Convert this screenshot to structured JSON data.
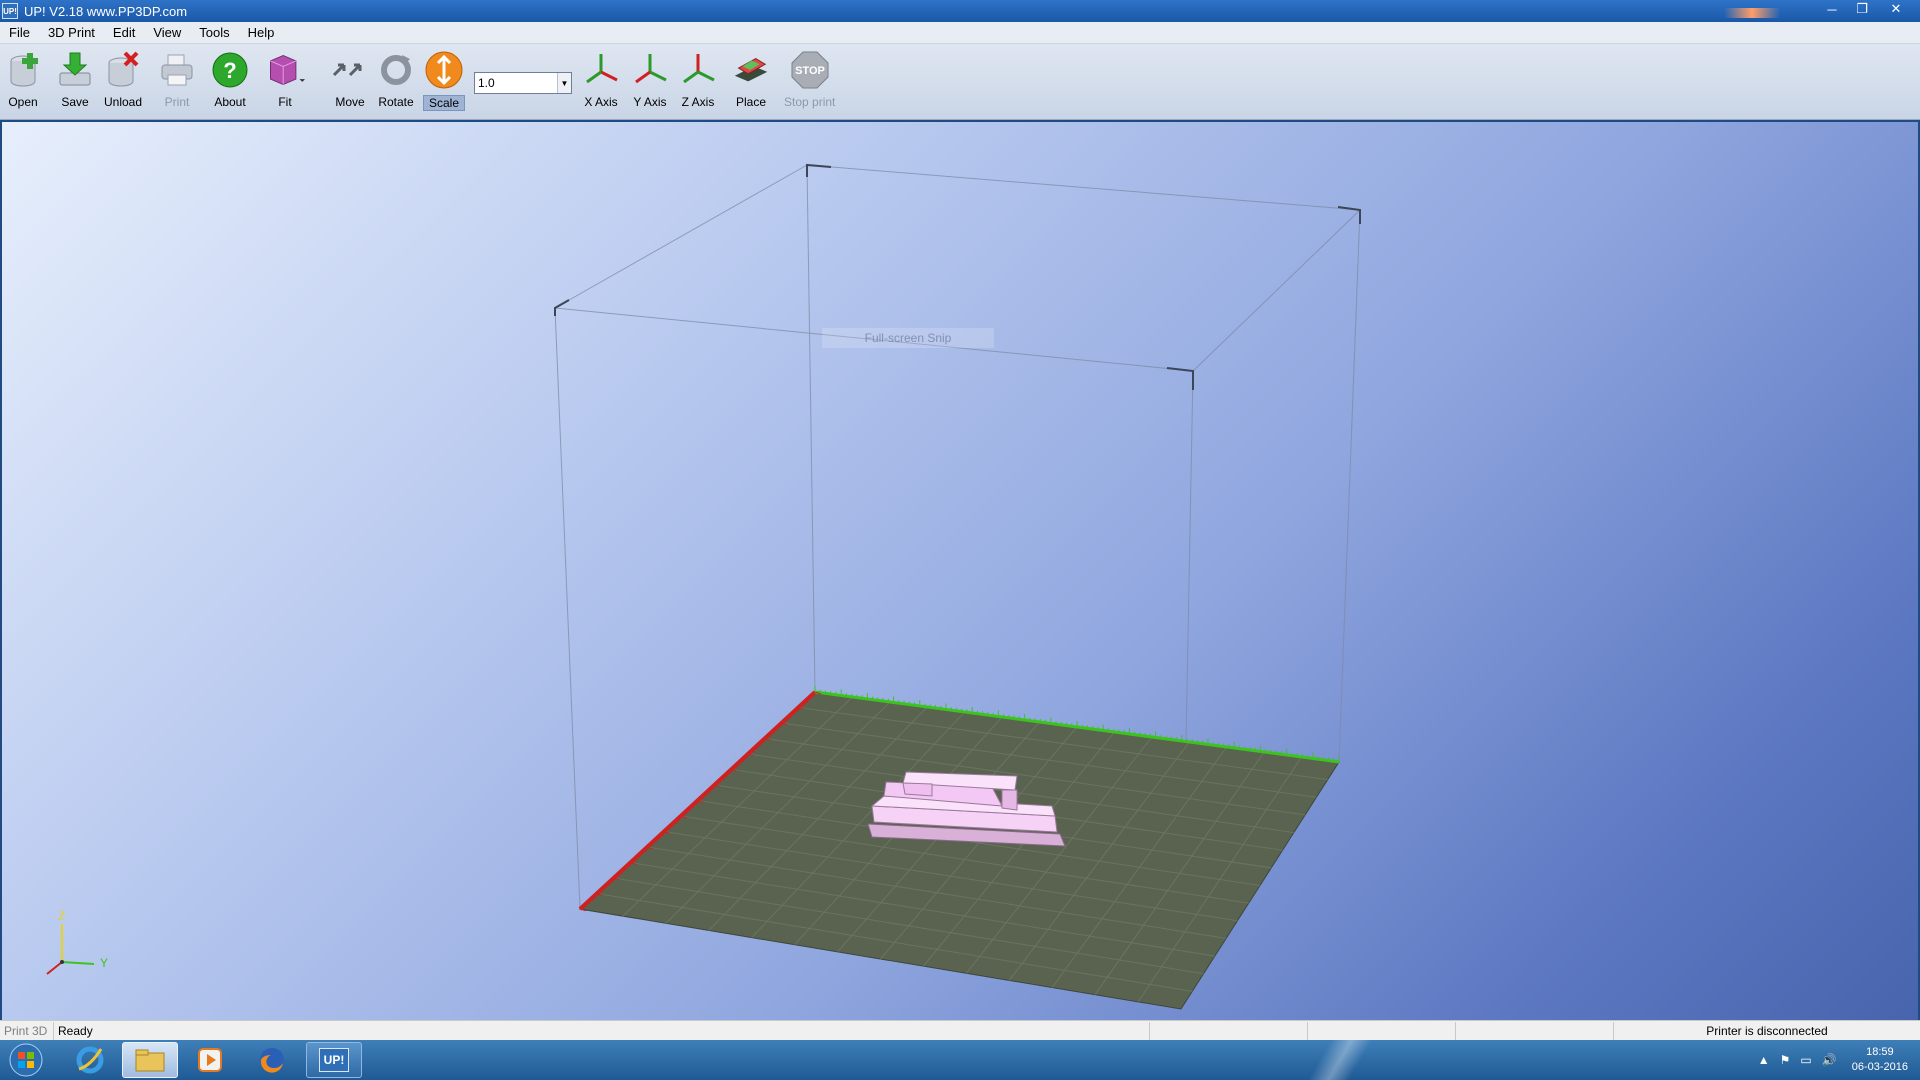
{
  "window": {
    "app_icon_text": "UP!",
    "title": "UP!  V2.18 www.PP3DP.com",
    "minimize": "─",
    "restore": "❐",
    "close": "✕"
  },
  "menu": [
    {
      "label": "File"
    },
    {
      "label": "3D Print"
    },
    {
      "label": "Edit"
    },
    {
      "label": "View"
    },
    {
      "label": "Tools"
    },
    {
      "label": "Help"
    }
  ],
  "toolbar": {
    "open": "Open",
    "save": "Save",
    "unload": "Unload",
    "print": "Print",
    "about": "About",
    "fit": "Fit",
    "move": "Move",
    "rotate": "Rotate",
    "scale": "Scale",
    "scale_value": "1.0",
    "x_axis": "X Axis",
    "y_axis": "Y Axis",
    "z_axis": "Z Axis",
    "place": "Place",
    "stop_print": "Stop print",
    "stop_icon_text": "STOP"
  },
  "viewport": {
    "overlay_text": "Full-screen Snip",
    "axis_z": "Z",
    "axis_y": "Y"
  },
  "statusbar": {
    "mode": "Print 3D",
    "state": "Ready",
    "printer": "Printer is disconnected"
  },
  "taskbar": {
    "app_label": "UP!",
    "time": "18:59",
    "date": "06-03-2016"
  },
  "colors": {
    "accent_active_scale": "#f08a1c",
    "bed": "#59634f",
    "model": "#f4c8f4",
    "x_ruler": "#d12020",
    "y_ruler": "#3cc31f"
  }
}
